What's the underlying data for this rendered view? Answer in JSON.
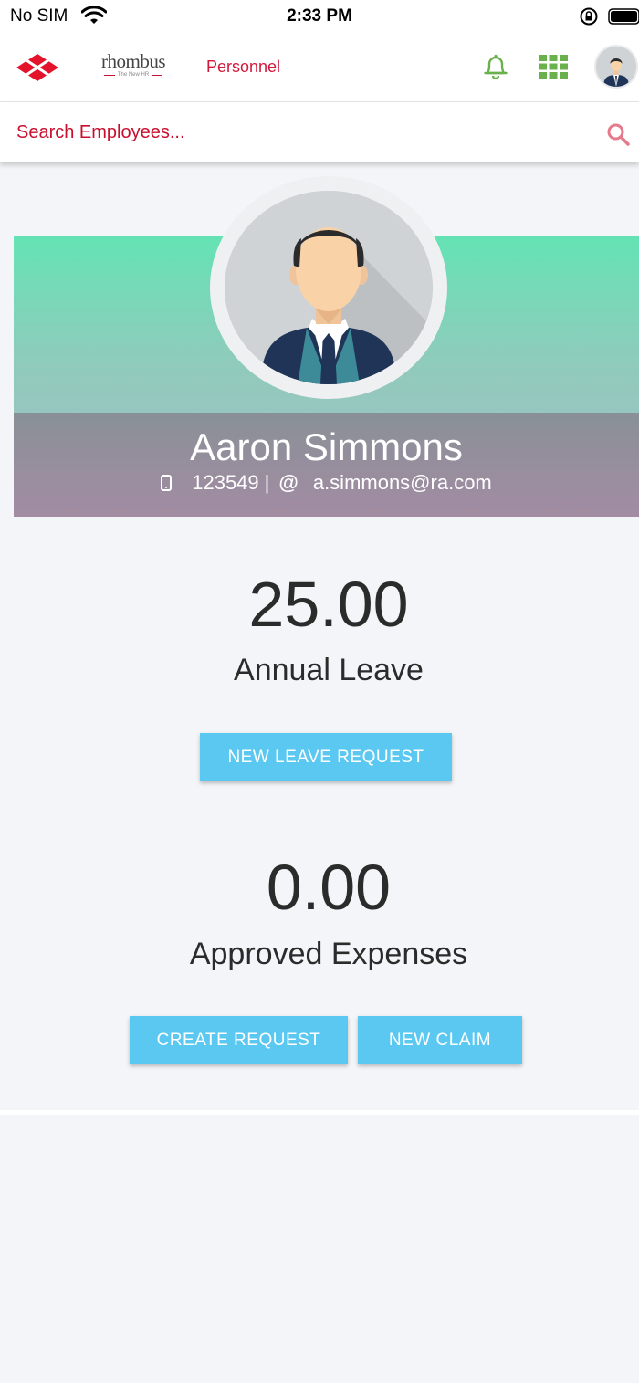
{
  "status_bar": {
    "carrier": "No SIM",
    "time": "2:33 PM"
  },
  "header": {
    "brand_name": "rhombus",
    "brand_tagline": "The New HR",
    "nav_label": "Personnel",
    "accent_color": "#d0193a",
    "icon_color": "#6ab04c"
  },
  "search": {
    "placeholder": "Search Employees..."
  },
  "profile": {
    "name": "Aaron Simmons",
    "phone": "123549",
    "separator": "|",
    "at_symbol": "@",
    "email": "a.simmons@ra.com"
  },
  "leave": {
    "value": "25.00",
    "label": "Annual Leave",
    "button_label": "NEW LEAVE REQUEST"
  },
  "expenses": {
    "value": "0.00",
    "label": "Approved Expenses",
    "create_button_label": "CREATE REQUEST",
    "claim_button_label": "NEW CLAIM"
  },
  "colors": {
    "button": "#5bc8f2",
    "card_top": "#64e3b4",
    "card_bottom": "#a38ca3"
  }
}
